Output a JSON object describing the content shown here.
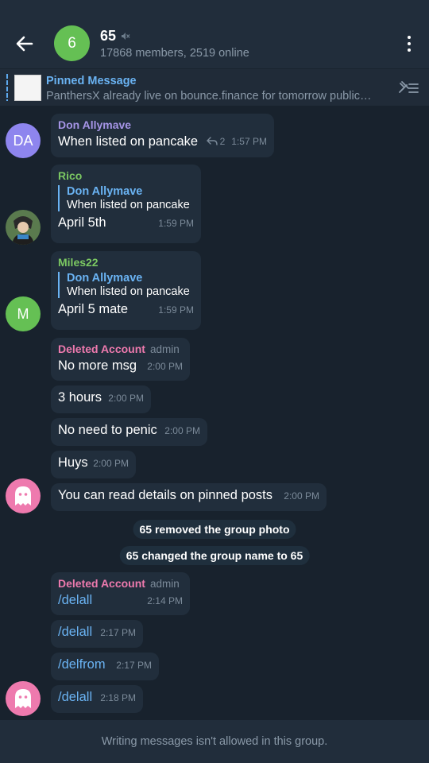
{
  "header": {
    "avatar_letter": "6",
    "title": "65",
    "subtitle": "17868 members, 2519 online",
    "avatar_color": "#65c054"
  },
  "pinned": {
    "title": "Pinned Message",
    "text": "PanthersX already live on bounce.finance  for tomorrow public…"
  },
  "messages": [
    {
      "avatar": "DA",
      "sender": "Don Allymave",
      "text": "When listed on pancake",
      "replies": "2",
      "time": "1:57 PM"
    },
    {
      "sender": "Rico",
      "reply_name": "Don Allymave",
      "reply_text": "When listed on pancake",
      "text": "April 5th",
      "time": "1:59 PM"
    },
    {
      "avatar": "M",
      "sender": "Miles22",
      "reply_name": "Don Allymave",
      "reply_text": "When listed on pancake",
      "text": "April 5 mate",
      "time": "1:59 PM"
    },
    {
      "sender": "Deleted Account",
      "badge": "admin",
      "text": "No more msg",
      "time": "2:00 PM"
    },
    {
      "text": "3 hours",
      "time": "2:00 PM"
    },
    {
      "text": "No need to penic",
      "time": "2:00 PM"
    },
    {
      "text": "Huys",
      "time": "2:00 PM"
    },
    {
      "text": "You can read details on pinned posts",
      "time": "2:00 PM"
    },
    {
      "sender": "Deleted Account",
      "badge": "admin",
      "text": "/delall",
      "time": "2:14 PM"
    },
    {
      "text": "/delall",
      "time": "2:17 PM"
    },
    {
      "text": "/delfrom",
      "time": "2:17 PM"
    },
    {
      "text": "/delall",
      "time": "2:18 PM"
    }
  ],
  "service": [
    "65 removed the group photo",
    "65 changed the group name to 65"
  ],
  "footer": {
    "text": "Writing messages isn't allowed in this group."
  },
  "colors": {
    "background": "#18222d",
    "bubble": "#212e3c",
    "link": "#6ab3f3",
    "sender_don": "#a695e7",
    "sender_green": "#7bc862",
    "sender_deleted": "#ee7aae",
    "avatar_don": "#8e85ee",
    "avatar_miles": "#65c054",
    "avatar_ghost": "#ee7aae"
  }
}
